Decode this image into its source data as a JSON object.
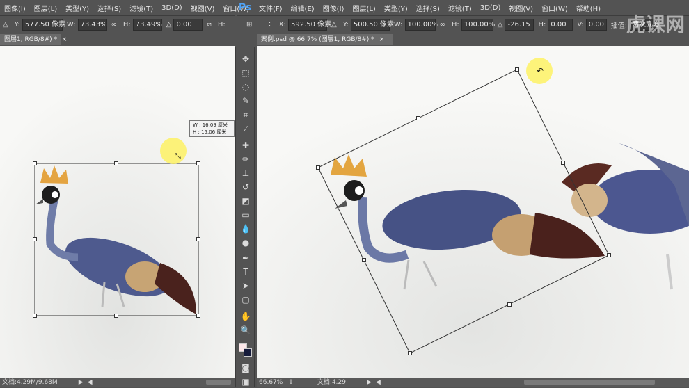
{
  "left_menu": [
    "图像(I)",
    "图层(L)",
    "类型(Y)",
    "选择(S)",
    "滤镜(T)",
    "3D(D)",
    "视图(V)",
    "窗口(W)"
  ],
  "right_menu": [
    "文件(F)",
    "编辑(E)",
    "图像(I)",
    "图层(L)",
    "类型(Y)",
    "选择(S)",
    "滤镜(T)",
    "3D(D)",
    "视图(V)",
    "窗口(W)",
    "帮助(H)"
  ],
  "ps_logo": "Ps",
  "left_options": {
    "y_label": "Y:",
    "y_value": "577.50 像素",
    "w_label": "W:",
    "w_value": "73.43%",
    "h_label": "H:",
    "h_value": "73.49%",
    "angle_label": "△",
    "angle_value": "0.00",
    "h_skew_label": "H:"
  },
  "right_options": {
    "x_label": "X:",
    "x_value": "592.50 像素",
    "y_label": "Y:",
    "y_value": "500.50 像素",
    "w_label": "W:",
    "w_value": "100.00%",
    "h_label": "H:",
    "h_value": "100.00%",
    "angle_label": "△",
    "angle_value": "-26.15",
    "h_skew_label": "H:",
    "h_skew_value": "0.00",
    "v_label": "V:",
    "v_value": "0.00",
    "interp_label": "插值:",
    "interp_value": "两次立方"
  },
  "left_tab": "图层1, RGB/8#) *",
  "left_tab_close": "×",
  "right_tab": "案例.psd @ 66.7% (图层1, RGB/8#) *",
  "right_tab_close": "×",
  "left_status": "文档:4.29M/9.68M",
  "right_zoom": "66.67%",
  "right_status": "文档:4.29",
  "info_w": "W :  16.09 厘米",
  "info_h": "H :  15.06 厘米",
  "watermark": "虎课网",
  "tools": [
    "move-icon",
    "marquee-icon",
    "lasso-icon",
    "quick-select-icon",
    "crop-icon",
    "eyedropper-icon",
    "healing-icon",
    "brush-icon",
    "stamp-icon",
    "history-brush-icon",
    "eraser-icon",
    "gradient-icon",
    "blur-icon",
    "dodge-icon",
    "pen-icon",
    "type-icon",
    "path-select-icon",
    "shape-icon",
    "hand-icon",
    "zoom-icon"
  ],
  "tool_glyphs": [
    "✥",
    "⬚",
    "◌",
    "✎",
    "⌗",
    "⌿",
    "✚",
    "✏",
    "⊥",
    "↺",
    "◩",
    "▭",
    "💧",
    "●",
    "✒",
    "T",
    "➤",
    "▢",
    "✋",
    "🔍"
  ],
  "colors": {
    "ui": "#535353",
    "canvas": "#f7f7f5",
    "highlight": "#fff250"
  }
}
